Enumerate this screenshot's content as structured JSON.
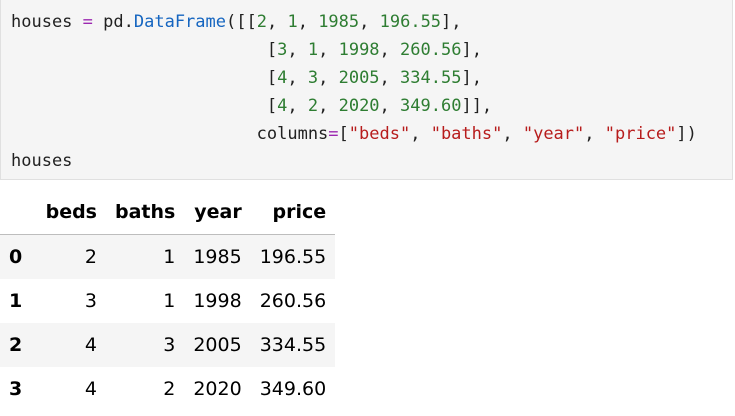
{
  "code_cell": {
    "line1": {
      "var": "houses",
      "assign": " = ",
      "module": "pd",
      "dot": ".",
      "func": "DataFrame",
      "open": "([[",
      "n1": "2",
      "s1": ", ",
      "n2": "1",
      "s2": ", ",
      "n3": "1985",
      "s3": ", ",
      "n4": "196.55",
      "close": "],"
    },
    "line2": {
      "indent": "                         ",
      "open": "[",
      "n1": "3",
      "s1": ", ",
      "n2": "1",
      "s2": ", ",
      "n3": "1998",
      "s3": ", ",
      "n4": "260.56",
      "close": "],"
    },
    "line3": {
      "indent": "                         ",
      "open": "[",
      "n1": "4",
      "s1": ", ",
      "n2": "3",
      "s2": ", ",
      "n3": "2005",
      "s3": ", ",
      "n4": "334.55",
      "close": "],"
    },
    "line4": {
      "indent": "                         ",
      "open": "[",
      "n1": "4",
      "s1": ", ",
      "n2": "2",
      "s2": ", ",
      "n3": "2020",
      "s3": ", ",
      "n4": "349.60",
      "close": "]],"
    },
    "line5": {
      "indent": "                        ",
      "kw": "columns",
      "eq": "=",
      "open": "[",
      "c1": "\"beds\"",
      "s1": ", ",
      "c2": "\"baths\"",
      "s2": ", ",
      "c3": "\"year\"",
      "s3": ", ",
      "c4": "\"price\"",
      "close": "])"
    },
    "line6": {
      "var": "houses"
    }
  },
  "output_table": {
    "index_header": "",
    "columns": [
      "beds",
      "baths",
      "year",
      "price"
    ],
    "rows": [
      {
        "index": "0",
        "beds": "2",
        "baths": "1",
        "year": "1985",
        "price": "196.55"
      },
      {
        "index": "1",
        "beds": "3",
        "baths": "1",
        "year": "1998",
        "price": "260.56"
      },
      {
        "index": "2",
        "beds": "4",
        "baths": "3",
        "year": "2005",
        "price": "334.55"
      },
      {
        "index": "3",
        "beds": "4",
        "baths": "2",
        "year": "2020",
        "price": "349.60"
      }
    ]
  },
  "colors": {
    "code_background": "#f5f5f5",
    "number": "#2e7d32",
    "string": "#b71c1c",
    "operator": "#9c27b0",
    "function": "#1565c0"
  }
}
